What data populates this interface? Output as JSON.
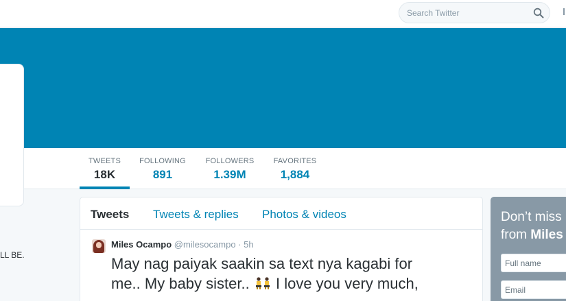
{
  "search": {
    "placeholder": "Search Twitter"
  },
  "colors": {
    "brand_blue": "#0084b4",
    "background": "#f5f8fa",
    "muted": "#8899a6",
    "signup_panel": "#8899a6"
  },
  "profile_nav": {
    "stats": [
      {
        "label": "TWEETS",
        "value": "18K",
        "active": true
      },
      {
        "label": "FOLLOWING",
        "value": "891",
        "active": false
      },
      {
        "label": "FOLLOWERS",
        "value": "1.39M",
        "active": false
      },
      {
        "label": "FAVORITES",
        "value": "1,884",
        "active": false
      }
    ]
  },
  "bio": {
    "snippet": "LL BE."
  },
  "timeline": {
    "tabs": [
      {
        "label": "Tweets",
        "active": true
      },
      {
        "label": "Tweets & replies",
        "active": false
      },
      {
        "label": "Photos & videos",
        "active": false
      }
    ],
    "tweet": {
      "name": "Miles Ocampo",
      "handle": "@milesocampo",
      "separator": "·",
      "time": "5h",
      "text_line1": "May nag paiyak saakin sa text nya kagabi for",
      "text_line2_before": "me.. My baby sister..",
      "emoji": "two-dancers-emoji",
      "text_line2_after": "I love you very much,"
    }
  },
  "signup": {
    "headline_line1": "Don’t miss",
    "headline_line2_prefix": "from",
    "headline_line2_name": "Miles",
    "full_name_placeholder": "Full name",
    "email_placeholder": "Email"
  }
}
